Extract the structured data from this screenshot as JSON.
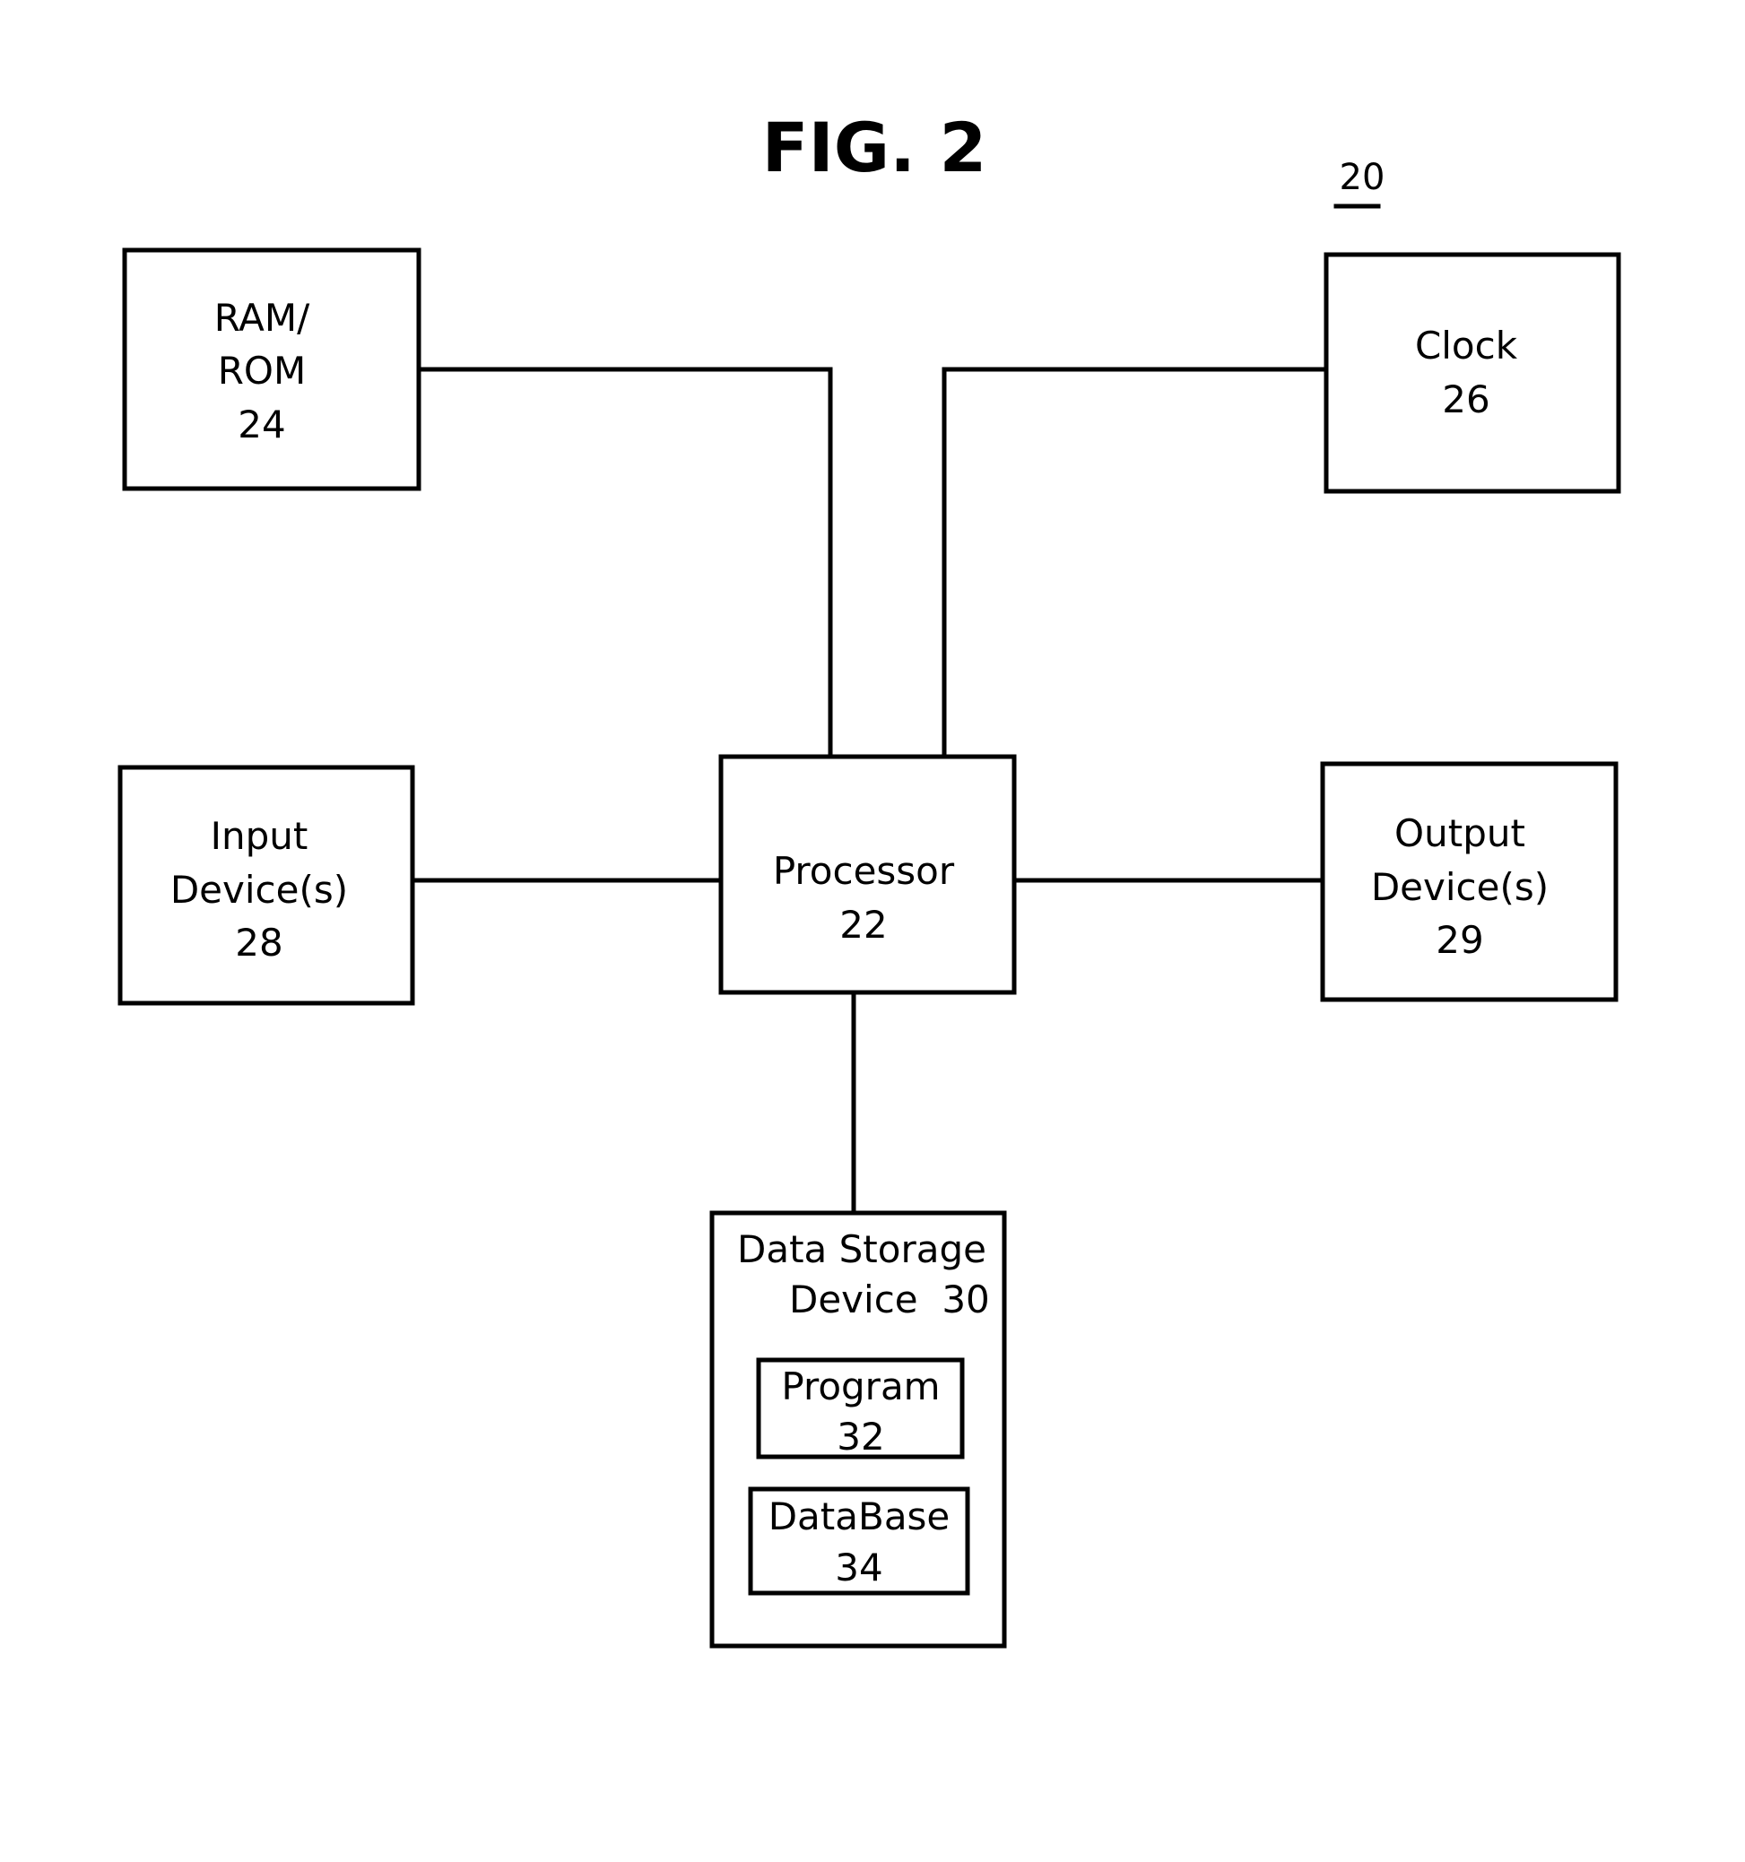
{
  "figure": {
    "title": "FIG. 2",
    "reference_numeral": "20"
  },
  "blocks": {
    "ram_rom": {
      "lines": [
        "RAM/",
        "ROM",
        "24"
      ]
    },
    "clock": {
      "lines": [
        "Clock",
        "26"
      ]
    },
    "input": {
      "lines": [
        "Input",
        "Device(s)",
        "28"
      ]
    },
    "processor": {
      "lines": [
        "Processor",
        "22"
      ]
    },
    "output": {
      "lines": [
        "Output",
        "Device(s)",
        "29"
      ]
    },
    "storage": {
      "lines": [
        "Data Storage",
        "Device  30"
      ]
    },
    "program": {
      "lines": [
        "Program",
        "32"
      ]
    },
    "database": {
      "lines": [
        "DataBase",
        "34"
      ]
    }
  },
  "connections": [
    {
      "from": "ram_rom",
      "to": "processor"
    },
    {
      "from": "clock",
      "to": "processor"
    },
    {
      "from": "input",
      "to": "processor"
    },
    {
      "from": "output",
      "to": "processor"
    },
    {
      "from": "processor",
      "to": "storage"
    }
  ],
  "colors": {
    "stroke": "#000000",
    "background": "#ffffff"
  }
}
